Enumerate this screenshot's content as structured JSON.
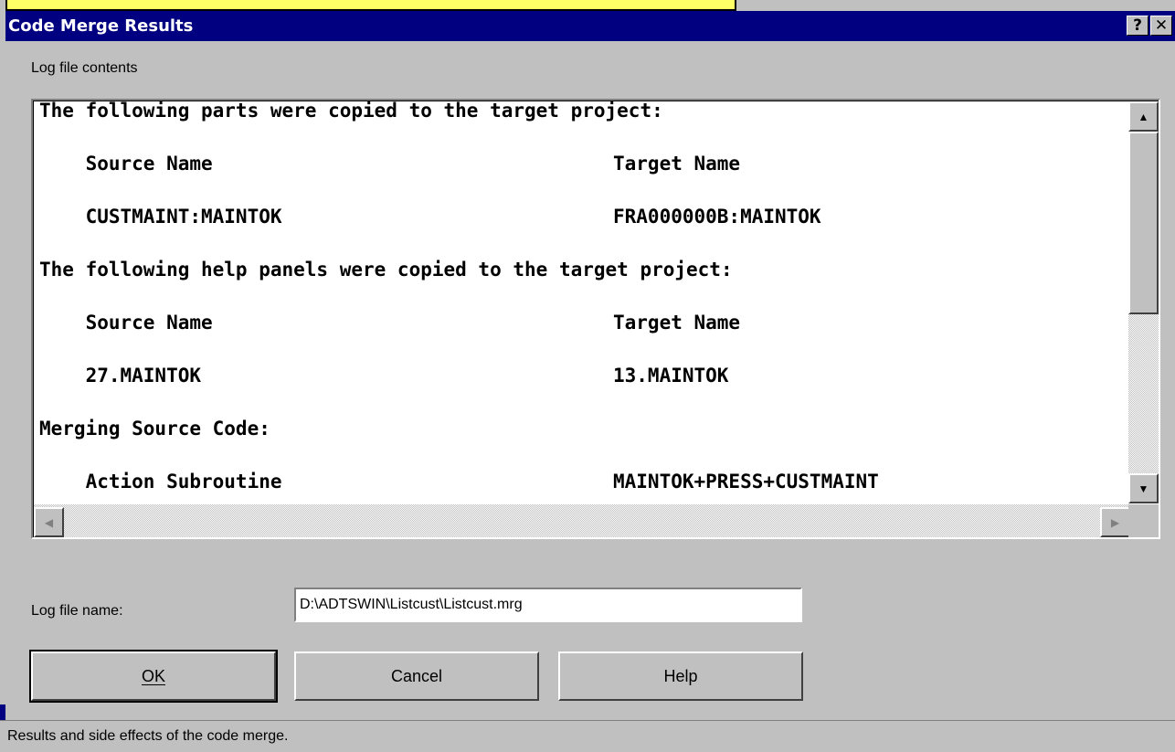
{
  "window": {
    "title": "Code Merge Results",
    "help_glyph": "?",
    "close_glyph": "✕"
  },
  "log": {
    "label": "Log file contents",
    "lines": [
      {
        "left": "The following parts were copied to the target project:",
        "right": ""
      },
      {
        "left": "    Source Name",
        "right": "Target Name"
      },
      {
        "left": "    CUSTMAINT:MAINTOK",
        "right": "FRA000000B:MAINTOK"
      },
      {
        "left": "The following help panels were copied to the target project:",
        "right": ""
      },
      {
        "left": "    Source Name",
        "right": "Target Name"
      },
      {
        "left": "    27.MAINTOK",
        "right": "13.MAINTOK"
      },
      {
        "left": "Merging Source Code:",
        "right": ""
      },
      {
        "left": "    Action Subroutine",
        "right": "MAINTOK+PRESS+CUSTMAINT"
      }
    ]
  },
  "log_file": {
    "label": "Log file name:",
    "value": "D:\\ADTSWIN\\Listcust\\Listcust.mrg"
  },
  "buttons": {
    "ok": "OK",
    "cancel": "Cancel",
    "help": "Help"
  },
  "status": {
    "text": "Results and side effects of the code merge."
  }
}
